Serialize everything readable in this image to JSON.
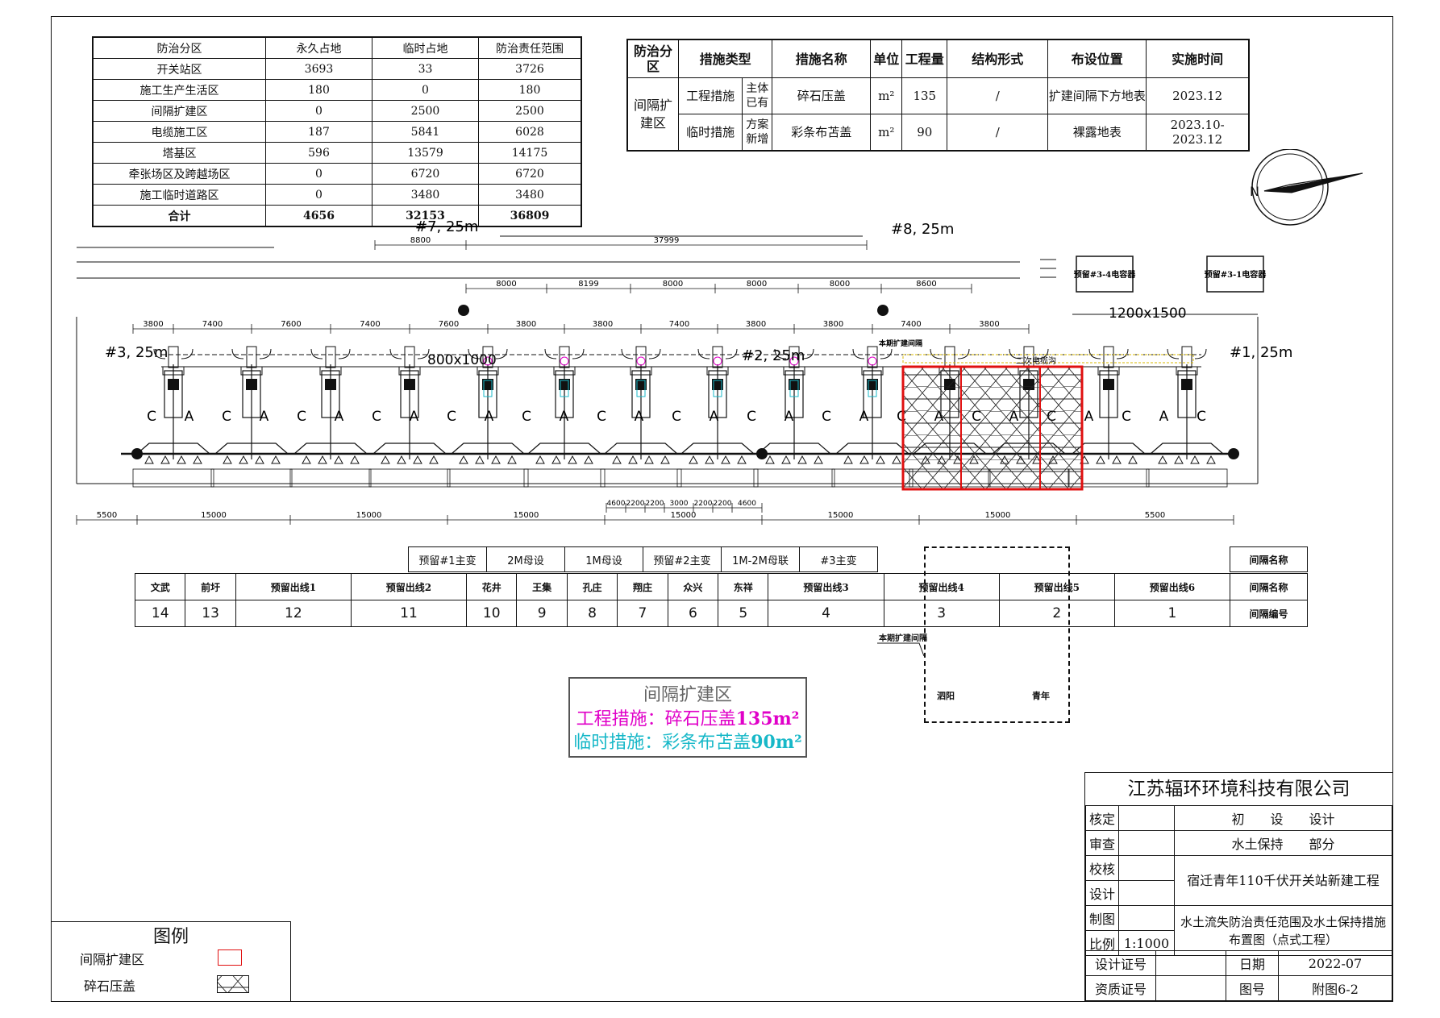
{
  "area_table": {
    "headers": [
      "防治分区",
      "永久占地",
      "临时占地",
      "防治责任范围"
    ],
    "rows": [
      [
        "开关站区",
        "3693",
        "33",
        "3726"
      ],
      [
        "施工生产生活区",
        "180",
        "0",
        "180"
      ],
      [
        "间隔扩建区",
        "0",
        "2500",
        "2500"
      ],
      [
        "电缆施工区",
        "187",
        "5841",
        "6028"
      ],
      [
        "塔基区",
        "596",
        "13579",
        "14175"
      ],
      [
        "牵张场区及跨越场区",
        "0",
        "6720",
        "6720"
      ],
      [
        "施工临时道路区",
        "0",
        "3480",
        "3480"
      ],
      [
        "合计",
        "4656",
        "32153",
        "36809"
      ]
    ]
  },
  "measures_table": {
    "headers": [
      "防治分区",
      "措施类型",
      "措施名称",
      "单位",
      "工程量",
      "结构形式",
      "布设位置",
      "实施时间"
    ],
    "zone": "间隔扩建区",
    "rows": [
      {
        "type": "工程措施",
        "sub": "主体已有",
        "name": "碎石压盖",
        "unit": "m²",
        "qty": "135",
        "structure": "/",
        "location": "扩建间隔下方地表",
        "time": "2023.12"
      },
      {
        "type": "临时措施",
        "sub": "方案新增",
        "name": "彩条布苫盖",
        "unit": "m²",
        "qty": "90",
        "structure": "/",
        "location": "裸露地表",
        "time": "2023.10-2023.12"
      }
    ]
  },
  "drawing": {
    "compass_label": "N",
    "grid_labels": [
      "#3, 25m",
      "#2, 25m",
      "#1, 25m",
      "#7, 25m",
      "#8, 25m"
    ],
    "top_dims": [
      "8800",
      "37999"
    ],
    "upper_dims": [
      "8000",
      "8199",
      "8000",
      "8000",
      "8000",
      "8600"
    ],
    "bay_dims": [
      "3800",
      "7400",
      "7600",
      "7400",
      "7600",
      "3800",
      "3800",
      "7400",
      "3800",
      "3800",
      "7400",
      "3800"
    ],
    "bottom_dims": [
      "5500",
      "15000",
      "15000",
      "15000",
      "15000",
      "15000",
      "15000",
      "5500"
    ],
    "sub_dims": [
      "4600",
      "2200",
      "2200",
      "3000",
      "2200",
      "2200",
      "4600"
    ],
    "section_labels": [
      "800x1000",
      "1200x1500",
      "二次电缆沟",
      "本期扩建间隔"
    ],
    "equipment_labels": [
      "预留#3-4电容器",
      "预留#3-1电容器"
    ],
    "phase_letters": [
      "C",
      "A",
      "C",
      "A",
      "C",
      "A",
      "C",
      "A",
      "C",
      "A",
      "C",
      "A",
      "C",
      "A",
      "C",
      "A",
      "C",
      "A",
      "C",
      "A",
      "C",
      "A",
      "C",
      "A",
      "C",
      "A",
      "C",
      "A",
      "C",
      "A"
    ]
  },
  "bay_table": {
    "top_row": [
      "预留#1主变",
      "2M母设",
      "1M母设",
      "预留#2主变",
      "1M-2M母联",
      "#3主变"
    ],
    "names": [
      "文武",
      "前圩",
      "预留出线1",
      "预留出线2",
      "花井",
      "王集",
      "孔庄",
      "翔庄",
      "众兴",
      "东祥",
      "预留出线3",
      "预留出线4",
      "预留出线5",
      "预留出线6"
    ],
    "numbers": [
      "14",
      "13",
      "12",
      "11",
      "10",
      "9",
      "8",
      "7",
      "6",
      "5",
      "4",
      "3",
      "2",
      "1"
    ],
    "row_titles": [
      "间隔名称",
      "间隔名称",
      "间隔编号"
    ],
    "expansion_label": "本期扩建间隔",
    "expansion_names": [
      "泗阳",
      "青年"
    ]
  },
  "note": {
    "title": "间隔扩建区",
    "line1_prefix": "工程措施：碎石压盖",
    "line1_value": "135m²",
    "line2_prefix": "临时措施：彩条布苫盖",
    "line2_value": "90m²"
  },
  "legend": {
    "title": "图例",
    "items": [
      "间隔扩建区",
      "碎石压盖"
    ]
  },
  "title_block": {
    "company": "江苏辐环环境科技有限公司",
    "rows": [
      {
        "label": "核定",
        "value": "初　　设　　设计"
      },
      {
        "label": "审查",
        "value": "水土保持　　部分"
      },
      {
        "label": "校核",
        "value": ""
      },
      {
        "label": "设计",
        "value": ""
      },
      {
        "label": "制图",
        "value": ""
      },
      {
        "label": "比例",
        "value": "1:1000"
      }
    ],
    "project": "宿迁青年110千伏开关站新建工程",
    "drawing_name": "水土流失防治责任范围及水土保持措施布置图（点式工程）",
    "design_cert_label": "设计证号",
    "qual_cert_label": "资质证号",
    "date_label": "日期",
    "date": "2022-07",
    "fig_label": "图号",
    "fig_no": "附图6-2"
  },
  "colors": {
    "expansion_border": "#e01010",
    "engineering": "#e000c8",
    "temporary": "#18b8c8",
    "cable_trench": "#d8b800"
  }
}
